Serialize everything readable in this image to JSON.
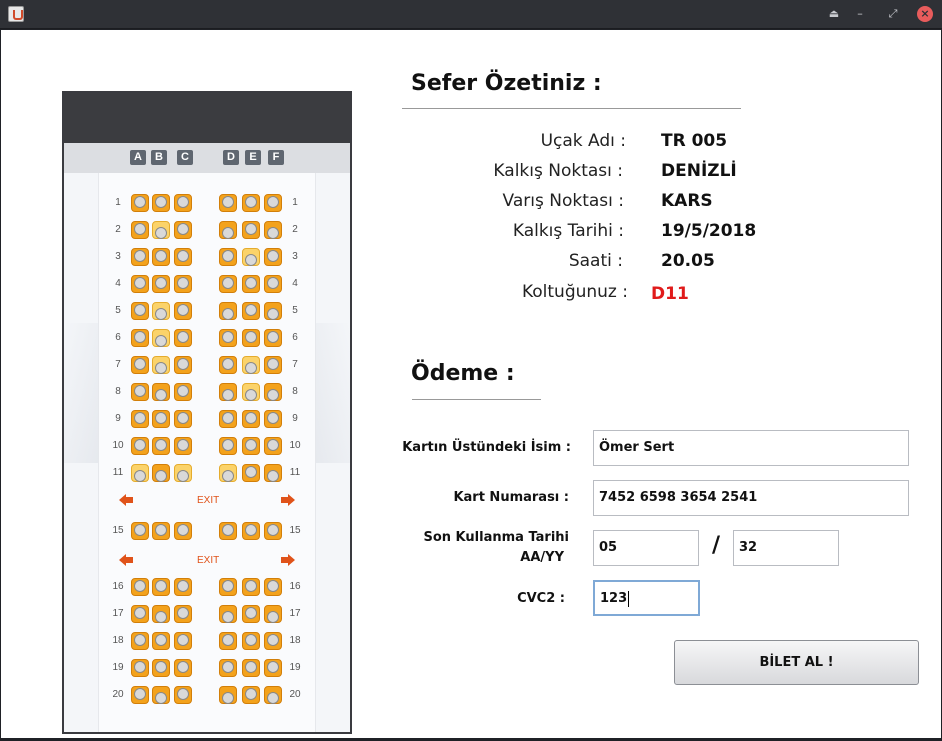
{
  "window": {
    "title": "",
    "controls": [
      "eject-icon",
      "minimize-icon",
      "restore-icon",
      "close-icon"
    ]
  },
  "seat_map": {
    "columns_left": [
      "A",
      "B",
      "C"
    ],
    "columns_right": [
      "D",
      "E",
      "F"
    ],
    "rows_top": [
      "1",
      "2",
      "3",
      "4",
      "5",
      "6",
      "7",
      "8",
      "9",
      "10",
      "11"
    ],
    "exit_row": [
      "15"
    ],
    "rows_bottom": [
      "16",
      "17",
      "18",
      "19",
      "20"
    ],
    "exit_label": "EXIT",
    "colors": {
      "seat": "#f3a21c",
      "seat_light": "#fbd36a",
      "exit": "#e0531a"
    }
  },
  "summary": {
    "title": "Sefer Özetiniz :",
    "items": [
      {
        "label": "Uçak Adı :",
        "value": "TR 005"
      },
      {
        "label": "Kalkış Noktası :",
        "value": "DENİZLİ"
      },
      {
        "label": "Varış Noktası :",
        "value": "KARS"
      },
      {
        "label": "Kalkış Tarihi :",
        "value": "19/5/2018"
      },
      {
        "label": "Saati :",
        "value": "20.05"
      },
      {
        "label": "Koltuğunuz :",
        "value": "D11"
      }
    ],
    "seat_value_color": "#e01b1b"
  },
  "payment": {
    "title": "Ödeme :",
    "card_name_label": "Kartın Üstündeki İsim :",
    "card_name_value": "Ömer Sert",
    "card_number_label": "Kart Numarası :",
    "card_number_value": "7452 6598 3654 2541",
    "expiry_label_1": "Son Kullanma Tarihi",
    "expiry_label_2": "AA/YY",
    "expiry_month": "05",
    "expiry_separator": "/",
    "expiry_year": "32",
    "cvc_label": "CVC2 :",
    "cvc_value": "123",
    "submit_label": "BİLET AL !"
  }
}
